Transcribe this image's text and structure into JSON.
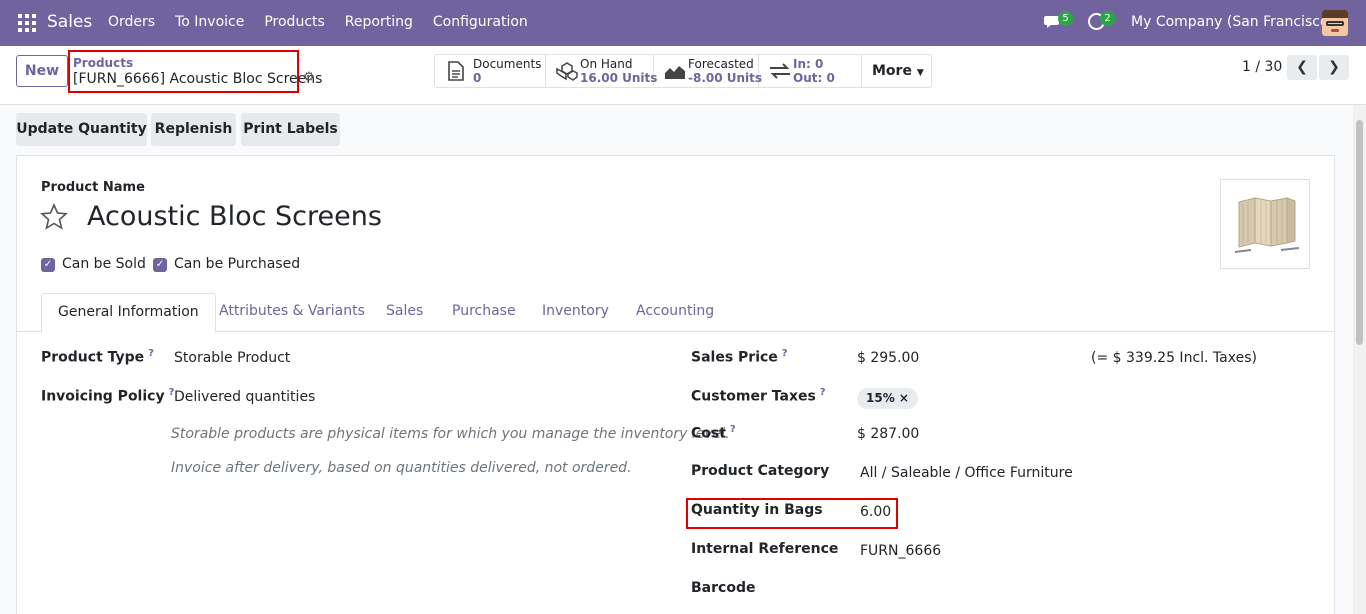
{
  "navbar": {
    "app_name": "Sales",
    "menu": [
      "Orders",
      "To Invoice",
      "Products",
      "Reporting",
      "Configuration"
    ],
    "chat_badge": "5",
    "activity_badge": "2",
    "company": "My Company (San Francisco)"
  },
  "control": {
    "new_label": "New",
    "breadcrumb_parent": "Products",
    "breadcrumb_current": "[FURN_6666] Acoustic Bloc Screens",
    "smart_buttons": {
      "documents": {
        "title": "Documents",
        "value": "0"
      },
      "on_hand": {
        "title": "On Hand",
        "value": "16.00 Units"
      },
      "forecasted": {
        "title": "Forecasted",
        "value": "-8.00 Units"
      },
      "in_out": {
        "in": "In: 0",
        "out": "Out: 0"
      },
      "more": "More"
    },
    "pager": "1 / 30"
  },
  "actions": {
    "update_quantity": "Update Quantity",
    "replenish": "Replenish",
    "print_labels": "Print Labels"
  },
  "product": {
    "name_label": "Product Name",
    "name": "Acoustic Bloc Screens",
    "can_be_sold": "Can be Sold",
    "can_be_purchased": "Can be Purchased"
  },
  "tabs": [
    "General Information",
    "Attributes & Variants",
    "Sales",
    "Purchase",
    "Inventory",
    "Accounting"
  ],
  "general": {
    "product_type_label": "Product Type",
    "product_type": "Storable Product",
    "invoicing_policy_label": "Invoicing Policy",
    "invoicing_policy": "Delivered quantities",
    "note_storable": "Storable products are physical items for which you manage the inventory level.",
    "note_invoice": "Invoice after delivery, based on quantities delivered, not ordered.",
    "sales_price_label": "Sales Price",
    "sales_price": "$ 295.00",
    "sales_price_incl": "(= $ 339.25 Incl. Taxes)",
    "customer_taxes_label": "Customer Taxes",
    "customer_tax_tag": "15%",
    "cost_label": "Cost",
    "cost": "$ 287.00",
    "product_category_label": "Product Category",
    "product_category": "All / Saleable / Office Furniture",
    "quantity_bags_label": "Quantity in Bags",
    "quantity_bags": "6.00",
    "internal_reference_label": "Internal Reference",
    "internal_reference": "FURN_6666",
    "barcode_label": "Barcode",
    "help_mark": "?"
  }
}
